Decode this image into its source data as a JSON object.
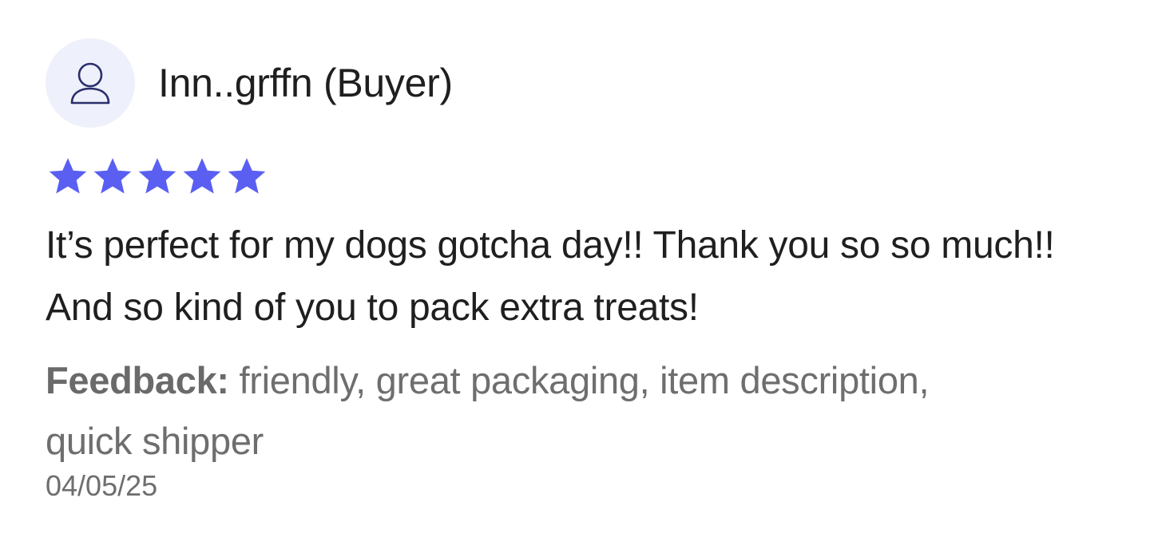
{
  "review": {
    "username": "Inn..grffn (Buyer)",
    "rating": 5,
    "rating_max": 5,
    "body": "It’s perfect for my dogs gotcha day!! Thank you so so much!! And so kind of you to pack extra treats!",
    "feedback_label": "Feedback:",
    "feedback_text": " friendly, great packaging, item description, quick shipper",
    "date": "04/05/25"
  },
  "icons": {
    "avatar": "user-icon",
    "star": "star-icon"
  },
  "colors": {
    "star": "#5a5ff2",
    "avatar_bg": "#eef0fb",
    "avatar_icon": "#2a2f6b",
    "muted_text": "#6e6e6e"
  }
}
